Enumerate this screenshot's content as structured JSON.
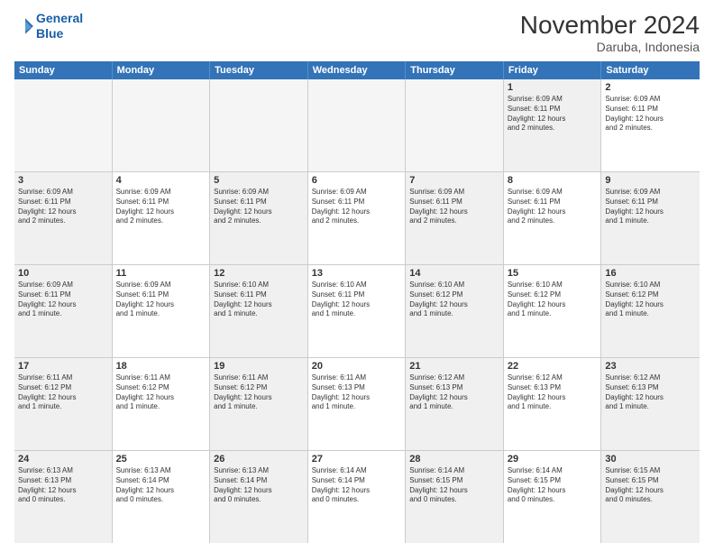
{
  "logo": {
    "line1": "General",
    "line2": "Blue"
  },
  "title": "November 2024",
  "subtitle": "Daruba, Indonesia",
  "headers": [
    "Sunday",
    "Monday",
    "Tuesday",
    "Wednesday",
    "Thursday",
    "Friday",
    "Saturday"
  ],
  "weeks": [
    [
      {
        "day": "",
        "text": "",
        "empty": true
      },
      {
        "day": "",
        "text": "",
        "empty": true
      },
      {
        "day": "",
        "text": "",
        "empty": true
      },
      {
        "day": "",
        "text": "",
        "empty": true
      },
      {
        "day": "",
        "text": "",
        "empty": true
      },
      {
        "day": "1",
        "text": "Sunrise: 6:09 AM\nSunset: 6:11 PM\nDaylight: 12 hours\nand 2 minutes.",
        "empty": false,
        "shaded": true
      },
      {
        "day": "2",
        "text": "Sunrise: 6:09 AM\nSunset: 6:11 PM\nDaylight: 12 hours\nand 2 minutes.",
        "empty": false
      }
    ],
    [
      {
        "day": "3",
        "text": "Sunrise: 6:09 AM\nSunset: 6:11 PM\nDaylight: 12 hours\nand 2 minutes.",
        "empty": false,
        "shaded": true
      },
      {
        "day": "4",
        "text": "Sunrise: 6:09 AM\nSunset: 6:11 PM\nDaylight: 12 hours\nand 2 minutes.",
        "empty": false
      },
      {
        "day": "5",
        "text": "Sunrise: 6:09 AM\nSunset: 6:11 PM\nDaylight: 12 hours\nand 2 minutes.",
        "empty": false,
        "shaded": true
      },
      {
        "day": "6",
        "text": "Sunrise: 6:09 AM\nSunset: 6:11 PM\nDaylight: 12 hours\nand 2 minutes.",
        "empty": false
      },
      {
        "day": "7",
        "text": "Sunrise: 6:09 AM\nSunset: 6:11 PM\nDaylight: 12 hours\nand 2 minutes.",
        "empty": false,
        "shaded": true
      },
      {
        "day": "8",
        "text": "Sunrise: 6:09 AM\nSunset: 6:11 PM\nDaylight: 12 hours\nand 2 minutes.",
        "empty": false
      },
      {
        "day": "9",
        "text": "Sunrise: 6:09 AM\nSunset: 6:11 PM\nDaylight: 12 hours\nand 1 minute.",
        "empty": false,
        "shaded": true
      }
    ],
    [
      {
        "day": "10",
        "text": "Sunrise: 6:09 AM\nSunset: 6:11 PM\nDaylight: 12 hours\nand 1 minute.",
        "empty": false,
        "shaded": true
      },
      {
        "day": "11",
        "text": "Sunrise: 6:09 AM\nSunset: 6:11 PM\nDaylight: 12 hours\nand 1 minute.",
        "empty": false
      },
      {
        "day": "12",
        "text": "Sunrise: 6:10 AM\nSunset: 6:11 PM\nDaylight: 12 hours\nand 1 minute.",
        "empty": false,
        "shaded": true
      },
      {
        "day": "13",
        "text": "Sunrise: 6:10 AM\nSunset: 6:11 PM\nDaylight: 12 hours\nand 1 minute.",
        "empty": false
      },
      {
        "day": "14",
        "text": "Sunrise: 6:10 AM\nSunset: 6:12 PM\nDaylight: 12 hours\nand 1 minute.",
        "empty": false,
        "shaded": true
      },
      {
        "day": "15",
        "text": "Sunrise: 6:10 AM\nSunset: 6:12 PM\nDaylight: 12 hours\nand 1 minute.",
        "empty": false
      },
      {
        "day": "16",
        "text": "Sunrise: 6:10 AM\nSunset: 6:12 PM\nDaylight: 12 hours\nand 1 minute.",
        "empty": false,
        "shaded": true
      }
    ],
    [
      {
        "day": "17",
        "text": "Sunrise: 6:11 AM\nSunset: 6:12 PM\nDaylight: 12 hours\nand 1 minute.",
        "empty": false,
        "shaded": true
      },
      {
        "day": "18",
        "text": "Sunrise: 6:11 AM\nSunset: 6:12 PM\nDaylight: 12 hours\nand 1 minute.",
        "empty": false
      },
      {
        "day": "19",
        "text": "Sunrise: 6:11 AM\nSunset: 6:12 PM\nDaylight: 12 hours\nand 1 minute.",
        "empty": false,
        "shaded": true
      },
      {
        "day": "20",
        "text": "Sunrise: 6:11 AM\nSunset: 6:13 PM\nDaylight: 12 hours\nand 1 minute.",
        "empty": false
      },
      {
        "day": "21",
        "text": "Sunrise: 6:12 AM\nSunset: 6:13 PM\nDaylight: 12 hours\nand 1 minute.",
        "empty": false,
        "shaded": true
      },
      {
        "day": "22",
        "text": "Sunrise: 6:12 AM\nSunset: 6:13 PM\nDaylight: 12 hours\nand 1 minute.",
        "empty": false
      },
      {
        "day": "23",
        "text": "Sunrise: 6:12 AM\nSunset: 6:13 PM\nDaylight: 12 hours\nand 1 minute.",
        "empty": false,
        "shaded": true
      }
    ],
    [
      {
        "day": "24",
        "text": "Sunrise: 6:13 AM\nSunset: 6:13 PM\nDaylight: 12 hours\nand 0 minutes.",
        "empty": false,
        "shaded": true
      },
      {
        "day": "25",
        "text": "Sunrise: 6:13 AM\nSunset: 6:14 PM\nDaylight: 12 hours\nand 0 minutes.",
        "empty": false
      },
      {
        "day": "26",
        "text": "Sunrise: 6:13 AM\nSunset: 6:14 PM\nDaylight: 12 hours\nand 0 minutes.",
        "empty": false,
        "shaded": true
      },
      {
        "day": "27",
        "text": "Sunrise: 6:14 AM\nSunset: 6:14 PM\nDaylight: 12 hours\nand 0 minutes.",
        "empty": false
      },
      {
        "day": "28",
        "text": "Sunrise: 6:14 AM\nSunset: 6:15 PM\nDaylight: 12 hours\nand 0 minutes.",
        "empty": false,
        "shaded": true
      },
      {
        "day": "29",
        "text": "Sunrise: 6:14 AM\nSunset: 6:15 PM\nDaylight: 12 hours\nand 0 minutes.",
        "empty": false
      },
      {
        "day": "30",
        "text": "Sunrise: 6:15 AM\nSunset: 6:15 PM\nDaylight: 12 hours\nand 0 minutes.",
        "empty": false,
        "shaded": true
      }
    ]
  ]
}
